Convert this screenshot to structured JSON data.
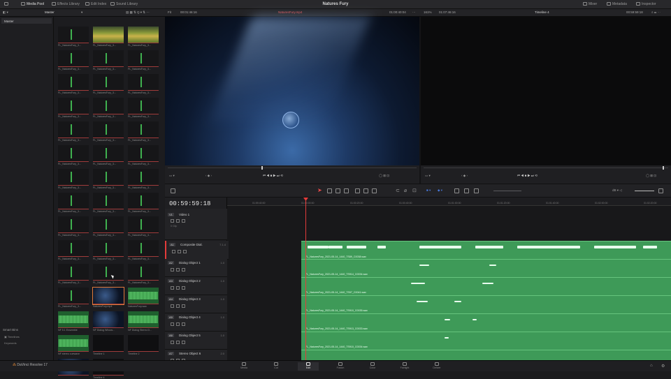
{
  "app": {
    "title": "Natures Fury",
    "brand": "DaVinci Resolve 17"
  },
  "top_tabs": [
    {
      "label": "Media Pool",
      "icon": "media-pool-icon"
    },
    {
      "label": "Effects Library",
      "icon": "effects-icon"
    },
    {
      "label": "Edit Index",
      "icon": "index-icon"
    },
    {
      "label": "Sound Library",
      "icon": "sound-library-icon"
    }
  ],
  "right_tabs": [
    {
      "label": "Mixer",
      "icon": "mixer-icon"
    },
    {
      "label": "Metadata",
      "icon": "metadata-icon"
    },
    {
      "label": "Inspector",
      "icon": "inspector-icon"
    }
  ],
  "viewer": {
    "source_zoom": "Fit",
    "source_tc": "00:01:46:16",
    "source_clip": "NaturesFury.mp4",
    "source_duration": "01:00:40:04",
    "record_zoom": "161%",
    "record_tc": "01:07:46:16",
    "timeline_name": "Timeline 4",
    "record_duration": "00:59:59:18"
  },
  "sidebar": {
    "master": "Master",
    "smart_bins_label": "Smart Bins",
    "smart_bins": [
      "Timelines",
      "Keywords"
    ]
  },
  "pool_header": {
    "bin": "Master"
  },
  "thumbnails": [
    {
      "label": "FL_NaturesFury_3...",
      "kind": "wave"
    },
    {
      "label": "FL_NaturesFury_3...",
      "kind": "clip"
    },
    {
      "label": "FL_NaturesFury_3...",
      "kind": "clip"
    },
    {
      "label": "FL_NaturesFury_3...",
      "kind": "wave"
    },
    {
      "label": "FL_NaturesFury_3...",
      "kind": "wave"
    },
    {
      "label": "FL_NaturesFury_3...",
      "kind": "wave"
    },
    {
      "label": "FL_NaturesFury_3...",
      "kind": "wave"
    },
    {
      "label": "FL_NaturesFury_3...",
      "kind": "wave"
    },
    {
      "label": "FL_NaturesFury_3...",
      "kind": "wave"
    },
    {
      "label": "FL_NaturesFury_3...",
      "kind": "wave"
    },
    {
      "label": "FL_NaturesFury_3...",
      "kind": "wave"
    },
    {
      "label": "FL_NaturesFury_3...",
      "kind": "wave"
    },
    {
      "label": "FL_NaturesFury_3...",
      "kind": "wave"
    },
    {
      "label": "FL_NaturesFury_3...",
      "kind": "wave"
    },
    {
      "label": "FL_NaturesFury_3...",
      "kind": "wave"
    },
    {
      "label": "FL_NaturesFury_3...",
      "kind": "wave"
    },
    {
      "label": "FL_NaturesFury_3...",
      "kind": "wave"
    },
    {
      "label": "FL_NaturesFury_3...",
      "kind": "wave"
    },
    {
      "label": "FL_NaturesFury_3...",
      "kind": "wave"
    },
    {
      "label": "FL_NaturesFury_3...",
      "kind": "wave"
    },
    {
      "label": "FL_NaturesFury_3...",
      "kind": "wave"
    },
    {
      "label": "FL_NaturesFury_3...",
      "kind": "wave"
    },
    {
      "label": "FL_NaturesFury_3...",
      "kind": "wave"
    },
    {
      "label": "FL_NaturesFury_3...",
      "kind": "wave"
    },
    {
      "label": "FL_NaturesFury_3...",
      "kind": "wave"
    },
    {
      "label": "FL_NaturesFury_3...",
      "kind": "wave"
    },
    {
      "label": "FL_NaturesFury_3...",
      "kind": "wave"
    },
    {
      "label": "FL_NaturesFury_3...",
      "kind": "wave"
    },
    {
      "label": "FL_NaturesFury_3...",
      "kind": "wave"
    },
    {
      "label": "FL_NaturesFury_3...",
      "kind": "wave"
    },
    {
      "label": "FL_NaturesFury_3...",
      "kind": "wave"
    },
    {
      "label": "FL_NaturesFury_3...",
      "kind": "wave"
    },
    {
      "label": "FL_NaturesFury_3...",
      "kind": "wave"
    },
    {
      "label": "FL_NaturesFury_3...",
      "kind": "wave"
    },
    {
      "label": "NaturesFury.mp4",
      "kind": "space"
    },
    {
      "label": "NaturesFury.wav",
      "kind": "audio"
    },
    {
      "label": "NF 5.1 Ensemble",
      "kind": "audio"
    },
    {
      "label": "NF Dialog Whoos...",
      "kind": "space"
    },
    {
      "label": "NF Dialog Stereo D...",
      "kind": "audio"
    },
    {
      "label": "NF stereo cuewave",
      "kind": "audio"
    },
    {
      "label": "Timeline 1",
      "kind": "dark"
    },
    {
      "label": "Timeline 2",
      "kind": "dark"
    },
    {
      "label": "",
      "kind": "space"
    },
    {
      "label": "Timeline 4",
      "kind": "dark"
    }
  ],
  "timeline": {
    "timecode": "00:59:59:18",
    "ruler": [
      "01:59:40:00",
      "01:00:00:00",
      "01:00:20:00",
      "01:00:40:00",
      "01:01:00:00",
      "01:01:20:00",
      "01:01:40:00",
      "01:02:00:00",
      "01:02:20:00"
    ],
    "video_track": {
      "id": "V1",
      "name": "Video 1",
      "clips": "0 Clip"
    },
    "audio_tracks": [
      {
        "id": "A1",
        "name": "Composite Dial.",
        "num": "7.1.4",
        "clip": "FL_NaturesFury_2021-05-14_1440_TS89_C0038.wav"
      },
      {
        "id": "A2",
        "name": "Dialog Object 1",
        "num": "1.0",
        "clip": "FL_NaturesFury_2021-05-14_1440_TS914_C0034.wav"
      },
      {
        "id": "A3",
        "name": "Dialog Object 2",
        "num": "1.0",
        "clip": "FL_NaturesFury_2021-05-14_1440_TS97_C0041.wav"
      },
      {
        "id": "A4",
        "name": "Dialog Object 3",
        "num": "1.0",
        "clip": "FL_NaturesFury_2021-05-14_1440_TS910_C0035.wav"
      },
      {
        "id": "A5",
        "name": "Dialog Object 4",
        "num": "1.0",
        "clip": "FL_NaturesFury_2021-05-14_1440_TS913_C0033.wav"
      },
      {
        "id": "A6",
        "name": "Dialog Object 5",
        "num": "1.0",
        "clip": "FL_NaturesFury_2021-05-14_1440_TS910_C0034.wav"
      },
      {
        "id": "A7",
        "name": "Stereo Object 6",
        "num": "2.0",
        "clip": ""
      }
    ]
  },
  "pages": [
    "Media",
    "Cut",
    "Edit",
    "Fusion",
    "Color",
    "Fairlight",
    "Deliver"
  ],
  "active_page": "Edit",
  "colors": {
    "accent_red": "#e33b3b",
    "audio_clip_green": "#3e9a58",
    "bg": "#1b1b1d"
  }
}
